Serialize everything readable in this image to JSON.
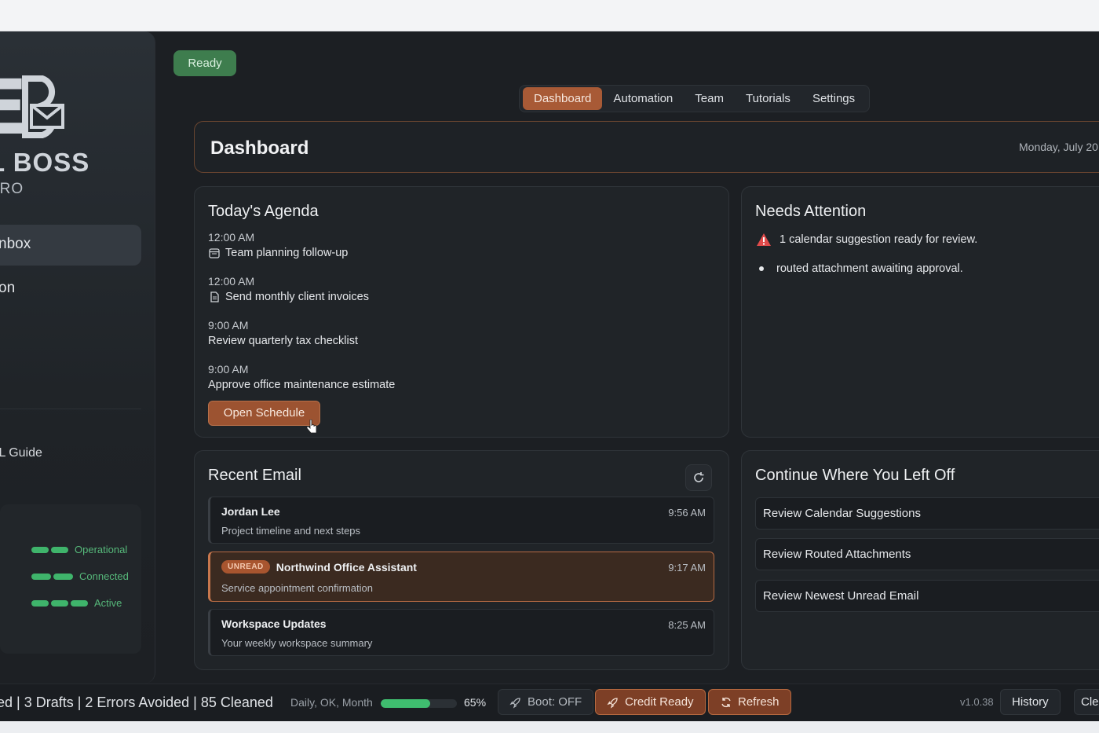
{
  "sidebar": {
    "logo_letters": "EB",
    "logo_text": "L BOSS",
    "logo_sub": "PRO",
    "nav": [
      {
        "label": "nbox",
        "active": true
      },
      {
        "label": "on",
        "active": false
      }
    ],
    "guide_label": "IL Guide",
    "status": [
      {
        "label": "Operational",
        "bars": 2
      },
      {
        "label": "Connected",
        "bars": 2
      },
      {
        "label": "Active",
        "bars": 3
      }
    ]
  },
  "ready_label": "Ready",
  "tabs": [
    {
      "label": "Dashboard",
      "active": true
    },
    {
      "label": "Automation",
      "active": false
    },
    {
      "label": "Team",
      "active": false
    },
    {
      "label": "Tutorials",
      "active": false
    },
    {
      "label": "Settings",
      "active": false
    }
  ],
  "header": {
    "title": "Dashboard",
    "date": "Monday, July 20"
  },
  "agenda": {
    "title": "Today's Agenda",
    "items": [
      {
        "time": "12:00 AM",
        "text": "Team planning follow-up",
        "icon": "calendar-icon"
      },
      {
        "time": "12:00 AM",
        "text": "Send monthly client invoices",
        "icon": "document-icon"
      },
      {
        "time": "9:00 AM",
        "text": "Review quarterly tax checklist",
        "icon": ""
      },
      {
        "time": "9:00 AM",
        "text": "Approve office maintenance estimate",
        "icon": ""
      }
    ],
    "button": "Open Schedule"
  },
  "attention": {
    "title": "Needs Attention",
    "items": [
      {
        "text": "1 calendar suggestion ready for review.",
        "icon": "warning-icon"
      },
      {
        "text": "routed attachment awaiting approval.",
        "icon": "bullet"
      }
    ]
  },
  "recent_email": {
    "title": "Recent Email",
    "emails": [
      {
        "from": "Jordan Lee",
        "subject": "Project timeline and next steps",
        "time": "9:56 AM",
        "unread": false
      },
      {
        "from": "Northwind Office Assistant",
        "subject": "Service appointment confirmation",
        "time": "9:17 AM",
        "unread": true,
        "badge": "UNREAD"
      },
      {
        "from": "Workspace Updates",
        "subject": "Your weekly workspace summary",
        "time": "8:25 AM",
        "unread": false
      }
    ]
  },
  "continue": {
    "title": "Continue Where You Left Off",
    "items": [
      "Review Calendar Suggestions",
      "Review Routed Attachments",
      "Review Newest Unread Email"
    ]
  },
  "statusbar": {
    "stats": "ed | 3 Drafts | 2 Errors Avoided | 85 Cleaned",
    "period": "Daily, OK, Month",
    "progress_pct": 65,
    "progress_label": "65%",
    "boot": "Boot: OFF",
    "credit": "Credit Ready",
    "refresh": "Refresh",
    "version": "v1.0.38",
    "history": "History",
    "clear": "Clea"
  },
  "colors": {
    "accent": "#a85a36",
    "success": "#3fb46b",
    "warning": "#e04b4b"
  }
}
